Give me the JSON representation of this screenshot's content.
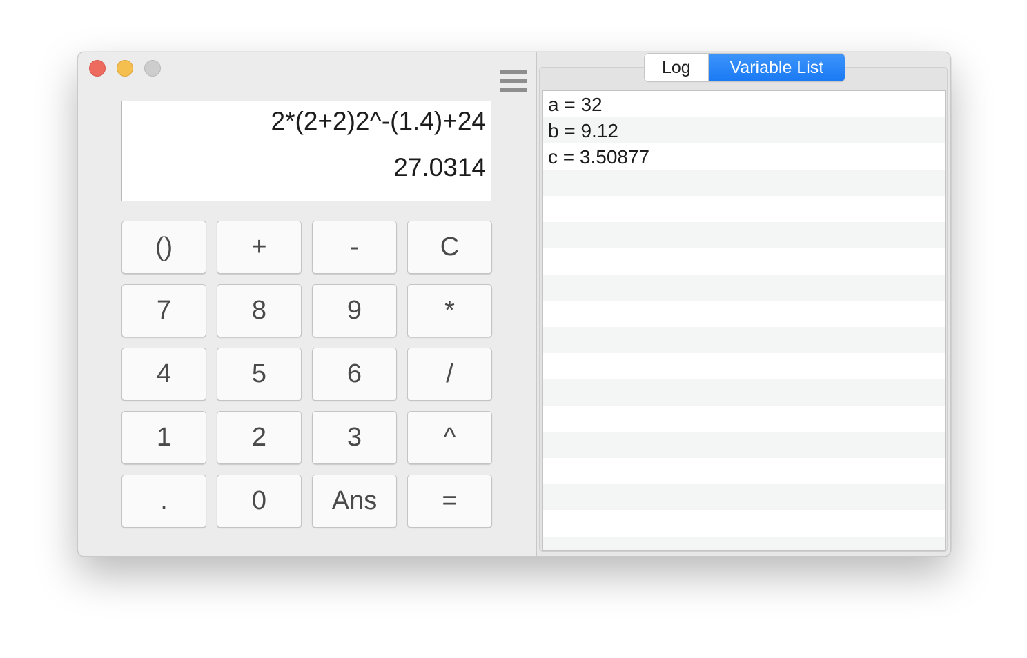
{
  "calculator": {
    "expression": "2*(2+2)2^-(1.4)+24",
    "result": "27.0314",
    "keys": [
      [
        "()",
        "+",
        "-",
        "C"
      ],
      [
        "7",
        "8",
        "9",
        "*"
      ],
      [
        "4",
        "5",
        "6",
        "/"
      ],
      [
        "1",
        "2",
        "3",
        "^"
      ],
      [
        ".",
        "0",
        "Ans",
        "="
      ]
    ]
  },
  "tabs": {
    "log_label": "Log",
    "variable_list_label": "Variable List",
    "selected": "Variable List"
  },
  "variables": [
    "a = 32",
    "b = 9.12",
    "c = 3.50877"
  ],
  "icons": {
    "menu": "hamburger-menu-icon"
  },
  "colors": {
    "accent": "#1a79f4",
    "close": "#ed6a5e",
    "minimize": "#f5bf4f",
    "zoom_inactive": "#cdcdcd"
  }
}
